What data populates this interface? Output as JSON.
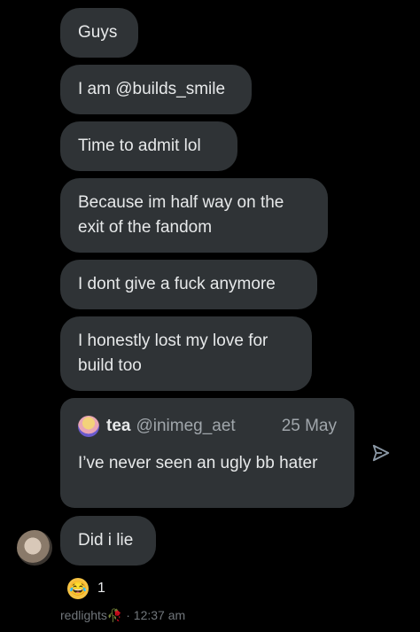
{
  "messages": [
    {
      "text": "Guys"
    },
    {
      "text": "I am @builds_smile"
    },
    {
      "text": "Time to admit lol"
    },
    {
      "text": "Because im half way on the exit of the fandom"
    },
    {
      "text": "I dont give a fuck anymore"
    },
    {
      "text": "I honestly lost my love for build too"
    }
  ],
  "quoted": {
    "name": "tea",
    "handle": "@inimeg_aet",
    "date": "25 May",
    "text": "I’ve never seen an ugly bb hater"
  },
  "reply": {
    "text": "Did i lie"
  },
  "reaction": {
    "emoji": "😂",
    "count": "1"
  },
  "meta": {
    "text": "redlights🥀 · 12:37 am"
  },
  "icons": {
    "share": "send-icon",
    "quote_avatar": "quote-avatar",
    "sender_avatar": "avatar"
  },
  "colors": {
    "background": "#000000",
    "bubble": "#2f3336",
    "text": "#e7e9ea",
    "muted": "#71767b"
  }
}
